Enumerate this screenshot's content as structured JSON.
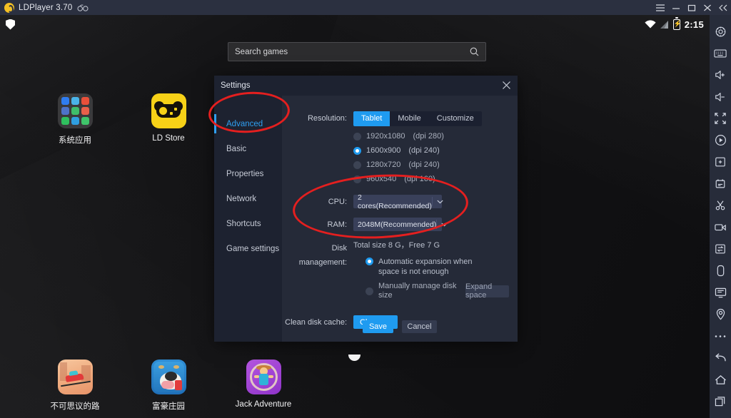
{
  "titlebar": {
    "app_name": "LDPlayer 3.70",
    "badge_icon": "goggles-icon",
    "controls": [
      {
        "name": "menu-button",
        "glyph": "hamburger"
      },
      {
        "name": "minimize-button",
        "glyph": "minimize"
      },
      {
        "name": "maximize-button",
        "glyph": "maximize"
      },
      {
        "name": "close-button",
        "glyph": "close"
      },
      {
        "name": "collapse-button",
        "glyph": "double-chevron-left"
      }
    ]
  },
  "android_status": {
    "left_icon": "shield-icon",
    "wifi": "wifi-icon",
    "signal": "signal-icon",
    "battery": "battery-charging-icon",
    "time": "2:15"
  },
  "search": {
    "placeholder": "Search games",
    "icon": "search-icon"
  },
  "desktop": {
    "icons": [
      {
        "label": "系统应用",
        "type": "folder"
      },
      {
        "label": "LD Store",
        "type": "ldstore"
      },
      {
        "label": "不可思议的路",
        "type": "road"
      },
      {
        "label": "富豪庄园",
        "type": "cow"
      },
      {
        "label": "Jack Adventure",
        "type": "jack"
      }
    ]
  },
  "dialog": {
    "title": "Settings",
    "close_icon": "close-icon",
    "sidebar": [
      {
        "label": "Advanced",
        "active": true
      },
      {
        "label": "Basic",
        "active": false
      },
      {
        "label": "Properties",
        "active": false
      },
      {
        "label": "Network",
        "active": false
      },
      {
        "label": "Shortcuts",
        "active": false
      },
      {
        "label": "Game settings",
        "active": false
      }
    ],
    "resolution": {
      "label": "Resolution:",
      "modes": [
        {
          "label": "Tablet",
          "active": true
        },
        {
          "label": "Mobile",
          "active": false
        },
        {
          "label": "Customize",
          "active": false
        }
      ],
      "options": [
        {
          "label": "1920x1080　(dpi 280)",
          "selected": false
        },
        {
          "label": "1600x900　(dpi 240)",
          "selected": true
        },
        {
          "label": "1280x720　(dpi 240)",
          "selected": false
        },
        {
          "label": "960x540　(dpi 160)",
          "selected": false
        }
      ]
    },
    "cpu": {
      "label": "CPU:",
      "value": "2 cores(Recommended)",
      "chevron": "chevron-down-icon"
    },
    "ram": {
      "label": "RAM:",
      "value": "2048M(Recommended)",
      "chevron": "chevron-down-icon"
    },
    "disk": {
      "label": "Disk management:",
      "summary": "Total size 8 G，Free 7 G",
      "auto_option": "Automatic expansion when space is not enough",
      "manual_option": "Manually manage disk size",
      "expand_button": "Expand space"
    },
    "clean": {
      "label": "Clean disk cache:",
      "button": "Clean up"
    },
    "footer": {
      "save": "Save",
      "cancel": "Cancel"
    },
    "accent_color": "#1f9bf0",
    "annotation_color": "#e41f1f"
  },
  "toolbar": {
    "items": [
      {
        "name": "settings-gear-icon",
        "highlighted": true
      },
      {
        "name": "keyboard-icon"
      },
      {
        "name": "volume-up-icon"
      },
      {
        "name": "volume-down-icon"
      },
      {
        "name": "fullscreen-icon"
      },
      {
        "name": "record-macro-icon"
      },
      {
        "name": "new-window-icon"
      },
      {
        "name": "multi-instance-sync-icon"
      },
      {
        "name": "scissors-screenshot-icon"
      },
      {
        "name": "video-record-icon"
      },
      {
        "name": "file-transfer-icon"
      },
      {
        "name": "shake-icon"
      },
      {
        "name": "virtual-screen-icon"
      },
      {
        "name": "location-icon"
      },
      {
        "name": "more-options-icon"
      }
    ],
    "nav": [
      {
        "name": "back-icon"
      },
      {
        "name": "home-icon"
      },
      {
        "name": "recents-icon"
      }
    ]
  }
}
